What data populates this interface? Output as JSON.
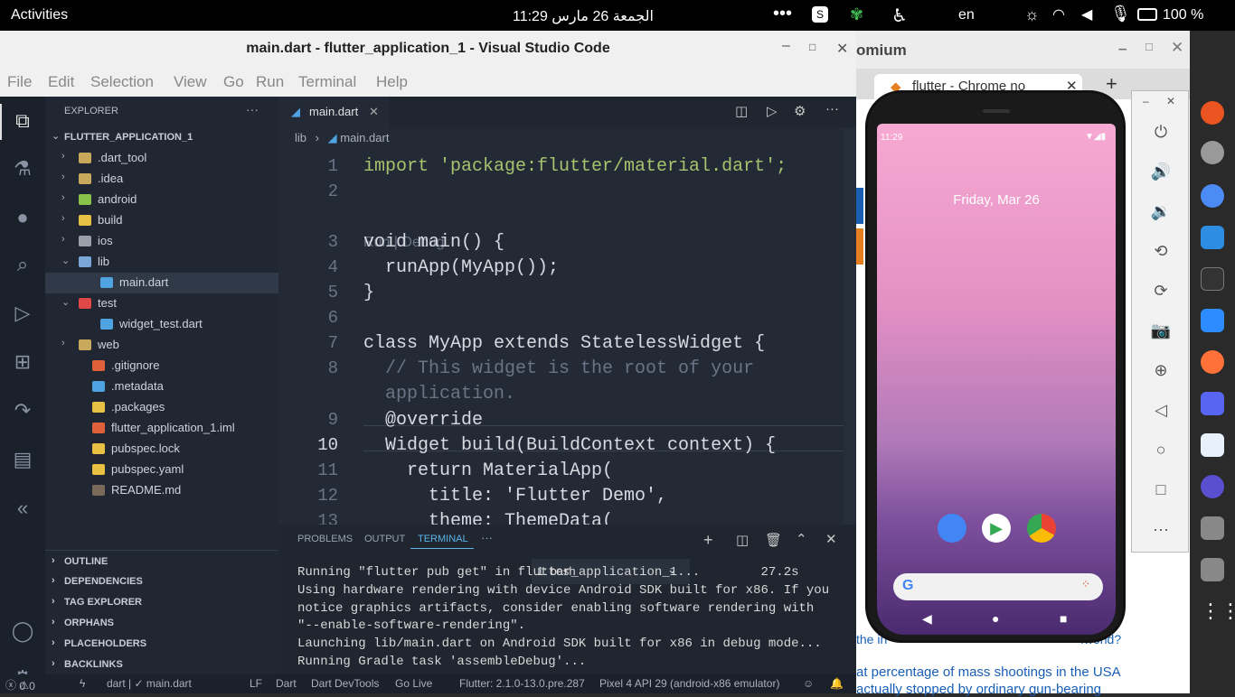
{
  "topbar": {
    "activities": "Activities",
    "clock": "11:29  الجمعة 26 مارس",
    "lang": "en",
    "battery": "100 %"
  },
  "vscode": {
    "title": "main.dart - flutter_application_1 - Visual Studio Code",
    "menu": [
      "File",
      "Edit",
      "Selection",
      "View",
      "Go",
      "Run",
      "Terminal",
      "Help"
    ],
    "explorer_label": "EXPLORER",
    "project": "FLUTTER_APPLICATION_1",
    "tree": [
      {
        "label": ".dart_tool",
        "chev": "›",
        "color": "#c8a85a"
      },
      {
        "label": ".idea",
        "chev": "›",
        "color": "#c8a85a"
      },
      {
        "label": "android",
        "chev": "›",
        "color": "#8ac34a"
      },
      {
        "label": "build",
        "chev": "›",
        "color": "#e8c044"
      },
      {
        "label": "ios",
        "chev": "›",
        "color": "#9aa0a8"
      },
      {
        "label": "lib",
        "chev": "⌄",
        "color": "#7aa6d8"
      },
      {
        "label": "main.dart",
        "chev": "",
        "color": "#4fa3e0"
      },
      {
        "label": "test",
        "chev": "⌄",
        "color": "#e04848"
      },
      {
        "label": "widget_test.dart",
        "chev": "",
        "color": "#4fa3e0"
      },
      {
        "label": "web",
        "chev": "›",
        "color": "#c8a85a"
      },
      {
        "label": ".gitignore",
        "chev": "",
        "color": "#e0603a"
      },
      {
        "label": ".metadata",
        "chev": "",
        "color": "#4fa3e0"
      },
      {
        "label": ".packages",
        "chev": "",
        "color": "#e8c044"
      },
      {
        "label": "flutter_application_1.iml",
        "chev": "",
        "color": "#e0603a"
      },
      {
        "label": "pubspec.lock",
        "chev": "",
        "color": "#e8c044"
      },
      {
        "label": "pubspec.yaml",
        "chev": "",
        "color": "#e8c044"
      },
      {
        "label": "README.md",
        "chev": "",
        "color": "#7a6a5a"
      }
    ],
    "sections": [
      "OUTLINE",
      "DEPENDENCIES",
      "TAG EXPLORER",
      "ORPHANS",
      "PLACEHOLDERS",
      "BACKLINKS"
    ],
    "tab": "main.dart",
    "breadcrumb": {
      "folder": "lib",
      "file": "main.dart"
    },
    "codelens": "Run | Debug",
    "code": [
      {
        "n": "1",
        "t": "import 'package:flutter/material.dart';"
      },
      {
        "n": "2",
        "t": ""
      },
      {
        "n": "3",
        "t": "void main() {"
      },
      {
        "n": "4",
        "t": "  runApp(MyApp());"
      },
      {
        "n": "5",
        "t": "}"
      },
      {
        "n": "6",
        "t": ""
      },
      {
        "n": "7",
        "t": "class MyApp extends StatelessWidget {"
      },
      {
        "n": "8",
        "t": "  // This widget is the root of your"
      },
      {
        "n": "",
        "t": "  application."
      },
      {
        "n": "9",
        "t": "  @override"
      },
      {
        "n": "10",
        "t": "  Widget build(BuildContext context) {"
      },
      {
        "n": "11",
        "t": "    return MaterialApp("
      },
      {
        "n": "12",
        "t": "      title: 'Flutter Demo',"
      },
      {
        "n": "13",
        "t": "      theme: ThemeData("
      }
    ],
    "panel_tabs": [
      "PROBLEMS",
      "OUTPUT",
      "TERMINAL",
      "···"
    ],
    "terminal_select": "1: bash",
    "terminal": "Running \"flutter pub get\" in flutter_application_1...        27.2s\nUsing hardware rendering with device Android SDK built for x86. If you\nnotice graphics artifacts, consider enabling software rendering with\n\"--enable-software-rendering\".\nLaunching lib/main.dart on Android SDK built for x86 in debug mode...\nRunning Gradle task 'assembleDebug'...",
    "status": {
      "errors": "0",
      "warnings": "0",
      "dart": "dart | ✓ main.dart",
      "eol": "LF",
      "lang": "Dart",
      "devtools": "Dart DevTools",
      "golive": "Go Live",
      "flutter": "Flutter: 2.1.0-13.0.pre.287",
      "device": "Pixel 4 API 29 (android-x86 emulator)"
    }
  },
  "chromium": {
    "title": "omium",
    "tab": "flutter - Chrome no",
    "links": [
      "at percentage of mass shootings in the USA",
      "actually stopped by ordinary gun-bearing",
      "the in",
      ".world?"
    ]
  },
  "phone": {
    "time": "11:29",
    "date": "Friday, Mar 26"
  }
}
